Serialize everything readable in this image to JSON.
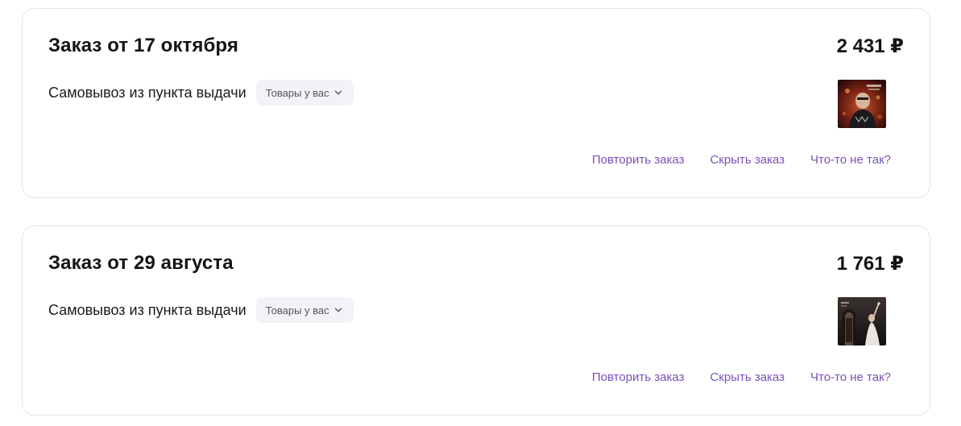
{
  "orders": [
    {
      "title": "Заказ от 17 октября",
      "price": "2 431 ₽",
      "delivery": "Самовывоз из пункта выдачи",
      "items_badge": "Товары у вас",
      "actions": {
        "repeat": "Повторить заказ",
        "hide": "Скрыть заказ",
        "problem": "Что-то не так?"
      }
    },
    {
      "title": "Заказ от 29 августа",
      "price": "1 761 ₽",
      "delivery": "Самовывоз из пункта выдачи",
      "items_badge": "Товары у вас",
      "actions": {
        "repeat": "Повторить заказ",
        "hide": "Скрыть заказ",
        "problem": "Что-то не так?"
      }
    }
  ],
  "colors": {
    "link": "#7c4fb7",
    "badge_bg": "#f2f3f7",
    "card_border": "#e6e6eb"
  },
  "icons": {
    "badge_chevron": "chevron-down-icon"
  }
}
